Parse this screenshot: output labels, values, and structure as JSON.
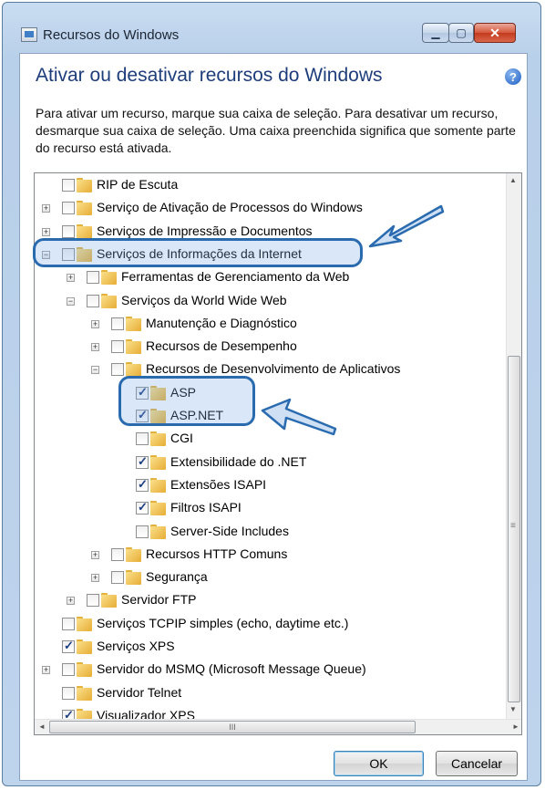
{
  "window": {
    "title": "Recursos do Windows",
    "close_glyph": "✕",
    "min_glyph": "▁",
    "max_glyph": "▢"
  },
  "heading": "Ativar ou desativar recursos do Windows",
  "help_glyph": "?",
  "description": "Para ativar um recurso, marque sua caixa de seleção. Para desativar um recurso, desmarque sua caixa de seleção. Uma caixa preenchida significa que somente parte do recurso está ativada.",
  "tree": [
    {
      "label": "RIP de Escuta",
      "level": 0,
      "expander": "none",
      "state": "unchecked"
    },
    {
      "label": "Serviço de Ativação de Processos do Windows",
      "level": 0,
      "expander": "+",
      "state": "unchecked"
    },
    {
      "label": "Serviços de Impressão e Documentos",
      "level": 0,
      "expander": "+",
      "state": "partial"
    },
    {
      "label": "Serviços de Informações da Internet",
      "level": 0,
      "expander": "-",
      "state": "partial"
    },
    {
      "label": "Ferramentas de Gerenciamento da Web",
      "level": 1,
      "expander": "+",
      "state": "partial"
    },
    {
      "label": "Serviços da World Wide Web",
      "level": 1,
      "expander": "-",
      "state": "partial"
    },
    {
      "label": "Manutenção e Diagnóstico",
      "level": 2,
      "expander": "+",
      "state": "partial"
    },
    {
      "label": "Recursos de Desempenho",
      "level": 2,
      "expander": "+",
      "state": "partial"
    },
    {
      "label": "Recursos de Desenvolvimento de Aplicativos",
      "level": 2,
      "expander": "-",
      "state": "partial"
    },
    {
      "label": "ASP",
      "level": 3,
      "expander": "none",
      "state": "checked"
    },
    {
      "label": "ASP.NET",
      "level": 3,
      "expander": "none",
      "state": "checked"
    },
    {
      "label": "CGI",
      "level": 3,
      "expander": "none",
      "state": "unchecked"
    },
    {
      "label": "Extensibilidade do .NET",
      "level": 3,
      "expander": "none",
      "state": "checked"
    },
    {
      "label": "Extensões ISAPI",
      "level": 3,
      "expander": "none",
      "state": "checked"
    },
    {
      "label": "Filtros ISAPI",
      "level": 3,
      "expander": "none",
      "state": "checked"
    },
    {
      "label": "Server-Side Includes",
      "level": 3,
      "expander": "none",
      "state": "unchecked"
    },
    {
      "label": "Recursos HTTP Comuns",
      "level": 2,
      "expander": "+",
      "state": "partial"
    },
    {
      "label": "Segurança",
      "level": 2,
      "expander": "+",
      "state": "partial"
    },
    {
      "label": "Servidor FTP",
      "level": 1,
      "expander": "+",
      "state": "unchecked"
    },
    {
      "label": "Serviços TCPIP simples (echo, daytime etc.)",
      "level": 0,
      "expander": "none",
      "state": "unchecked"
    },
    {
      "label": "Serviços XPS",
      "level": 0,
      "expander": "none",
      "state": "checked"
    },
    {
      "label": "Servidor do MSMQ (Microsoft Message Queue)",
      "level": 0,
      "expander": "+",
      "state": "unchecked"
    },
    {
      "label": "Servidor Telnet",
      "level": 0,
      "expander": "none",
      "state": "unchecked"
    },
    {
      "label": "Visualizador XPS",
      "level": 0,
      "expander": "none",
      "state": "checked"
    }
  ],
  "scroll": {
    "up": "▲",
    "down": "▼",
    "left": "◄",
    "right": "►",
    "grip": "III"
  },
  "buttons": {
    "ok": "OK",
    "cancel": "Cancelar"
  },
  "colors": {
    "highlight": "#2a6bb0",
    "heading": "#1e3d7b",
    "partial": "#1f4f99"
  }
}
